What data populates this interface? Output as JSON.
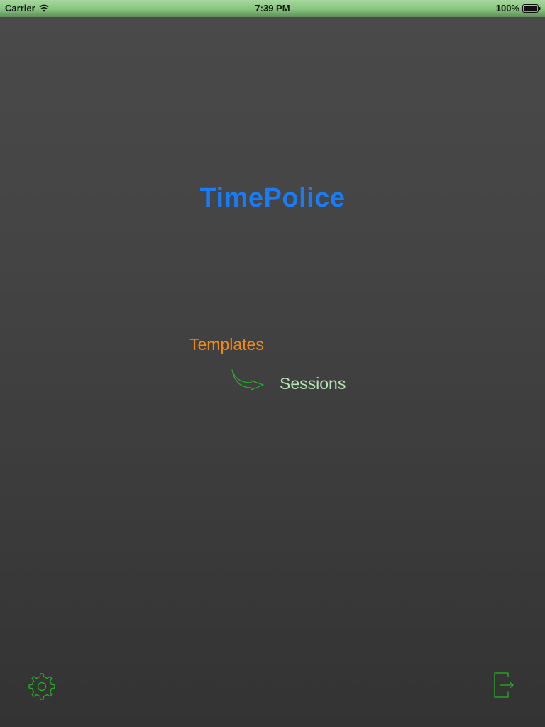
{
  "status_bar": {
    "carrier": "Carrier",
    "time": "7:39 PM",
    "battery": "100%"
  },
  "app": {
    "title": "TimePolice"
  },
  "navigation": {
    "templates_label": "Templates",
    "sessions_label": "Sessions"
  },
  "icons": {
    "settings": "gear-icon",
    "logout": "logout-icon",
    "flow_arrow": "curved-arrow-icon",
    "wifi": "wifi-icon",
    "battery": "battery-icon"
  },
  "colors": {
    "title": "#1a7cf5",
    "templates": "#f08a12",
    "sessions": "#b7e2b2",
    "icon_green": "#22b322",
    "status_bar": "#86c57d",
    "background_top": "#4a4a4a",
    "background_bottom": "#333333"
  }
}
